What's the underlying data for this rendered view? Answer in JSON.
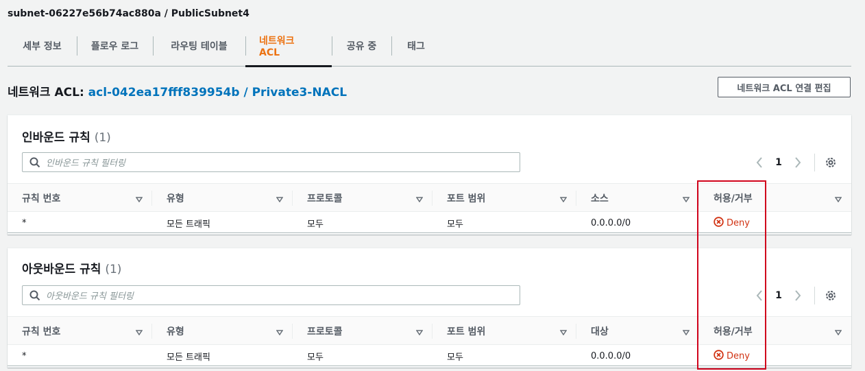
{
  "header": {
    "subnet_title": "subnet-06227e56b74ac880a / PublicSubnet4"
  },
  "tabs": [
    {
      "label": "세부 정보"
    },
    {
      "label": "플로우 로그"
    },
    {
      "label": "라우팅 테이블"
    },
    {
      "label": "네트워크 ACL",
      "active": true
    },
    {
      "label": "공유 중"
    },
    {
      "label": "태그"
    }
  ],
  "acl": {
    "prefix": "네트워크 ACL:",
    "link": "acl-042ea17fff839954b / Private3-NACL",
    "edit_button": "네트워크 ACL 연결 편집"
  },
  "inbound": {
    "title": "인바운드 규칙",
    "count": "(1)",
    "filter_placeholder": "인바운드 규칙 필터링",
    "page": "1",
    "columns": [
      "규칙 번호",
      "유형",
      "프로토콜",
      "포트 범위",
      "소스",
      "허용/거부"
    ],
    "rows": [
      {
        "rule": "*",
        "type": "모든 트래픽",
        "protocol": "모두",
        "port": "모두",
        "source": "0.0.0.0/0",
        "action": "Deny"
      }
    ]
  },
  "outbound": {
    "title": "아웃바운드 규칙",
    "count": "(1)",
    "filter_placeholder": "아웃바운드 규칙 필터링",
    "page": "1",
    "columns": [
      "규칙 번호",
      "유형",
      "프로토콜",
      "포트 범위",
      "대상",
      "허용/거부"
    ],
    "rows": [
      {
        "rule": "*",
        "type": "모든 트래픽",
        "protocol": "모두",
        "port": "모두",
        "source": "0.0.0.0/0",
        "action": "Deny"
      }
    ]
  },
  "colors": {
    "accent": "#ec7211",
    "link": "#0073bb",
    "deny": "#d13212",
    "highlight": "#d0021b"
  }
}
